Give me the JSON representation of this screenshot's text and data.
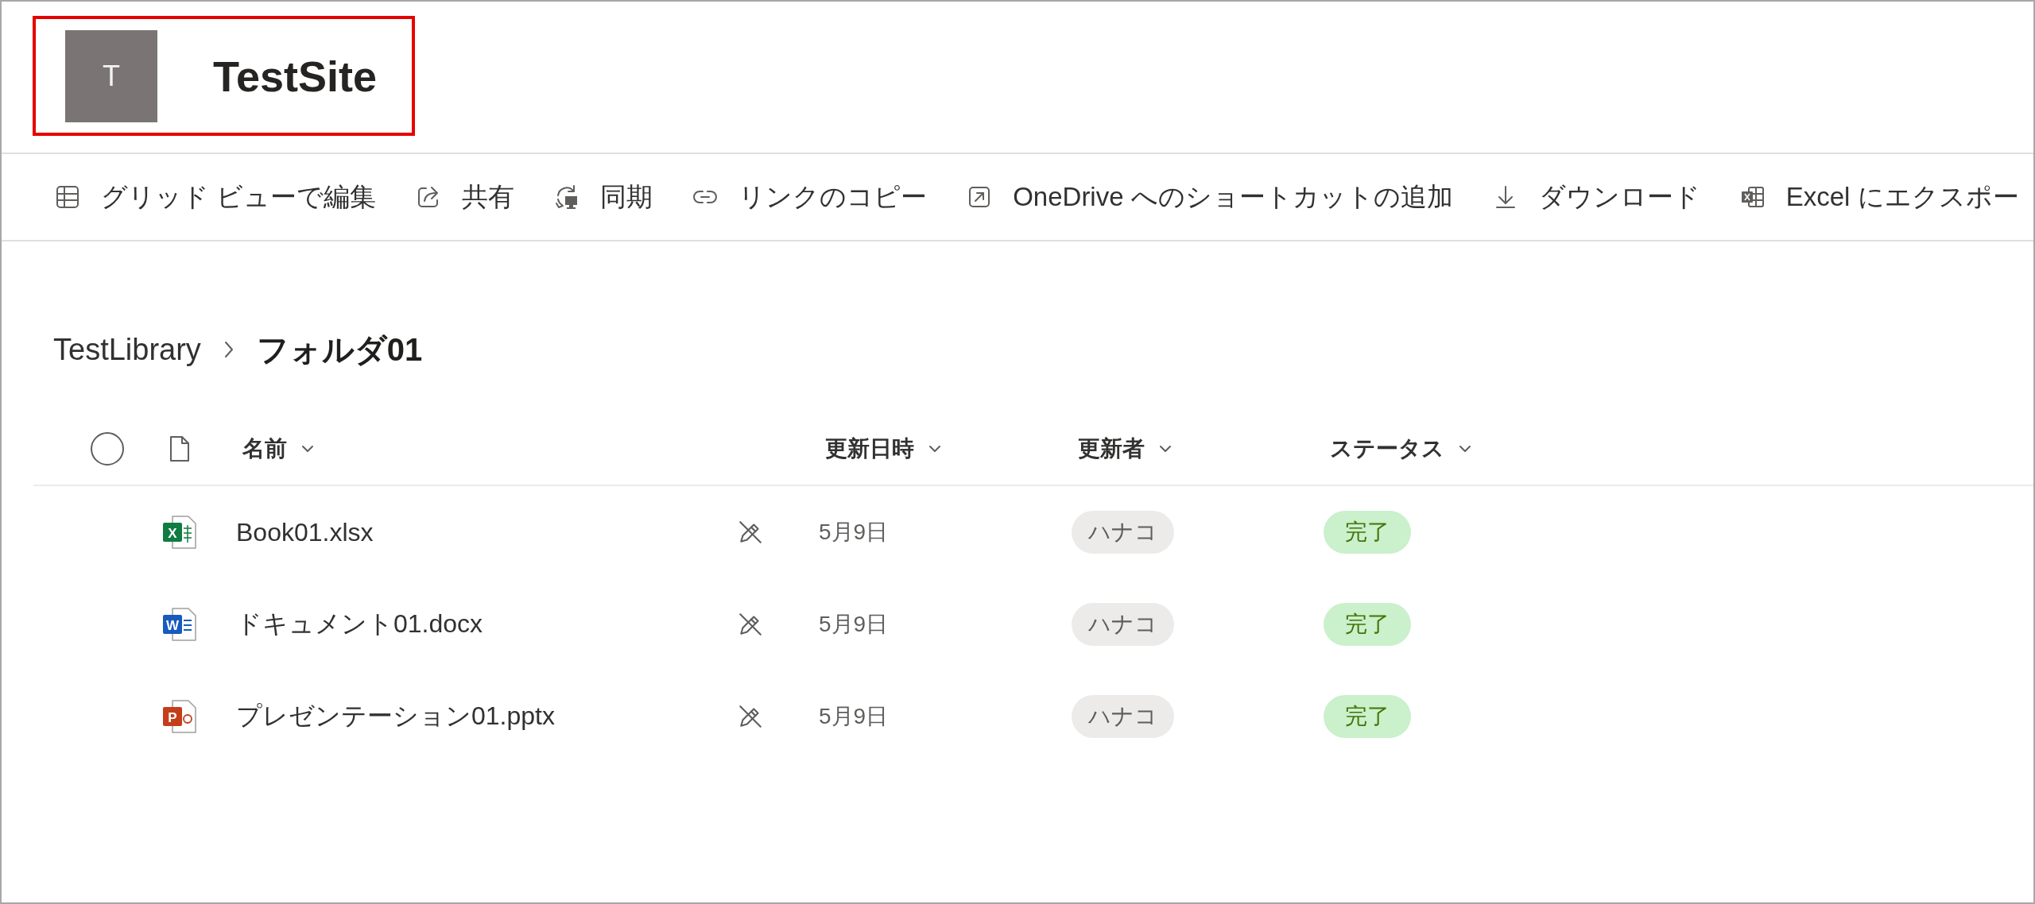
{
  "site": {
    "logo_letter": "T",
    "title": "TestSite",
    "highlighted": true
  },
  "toolbar": [
    {
      "label": "グリッド ビューで編集"
    },
    {
      "label": "共有"
    },
    {
      "label": "同期"
    },
    {
      "label": "リンクのコピー"
    },
    {
      "label": "OneDrive へのショートカットの追加"
    },
    {
      "label": "ダウンロード"
    },
    {
      "label": "Excel にエクスポー"
    }
  ],
  "breadcrumb": [
    {
      "label": "TestLibrary",
      "current": false
    },
    {
      "label": "フォルダ01",
      "current": true
    }
  ],
  "table": {
    "select_all": {
      "checked": false
    },
    "columns": [
      {
        "label": "名前"
      },
      {
        "label": "更新日時"
      },
      {
        "label": "更新者"
      },
      {
        "label": "ステータス"
      }
    ],
    "rows": [
      {
        "kind": "xlsx",
        "icon_letter": "X",
        "name": "Book01.xlsx",
        "modified": "5月9日",
        "modified_by": "ハナコ",
        "status": "完了"
      },
      {
        "kind": "docx",
        "icon_letter": "W",
        "name": "ドキュメント01.docx",
        "modified": "5月9日",
        "modified_by": "ハナコ",
        "status": "完了"
      },
      {
        "kind": "pptx",
        "icon_letter": "P",
        "name": "プレゼンテーション01.pptx",
        "modified": "5月9日",
        "modified_by": "ハナコ",
        "status": "完了"
      }
    ]
  }
}
